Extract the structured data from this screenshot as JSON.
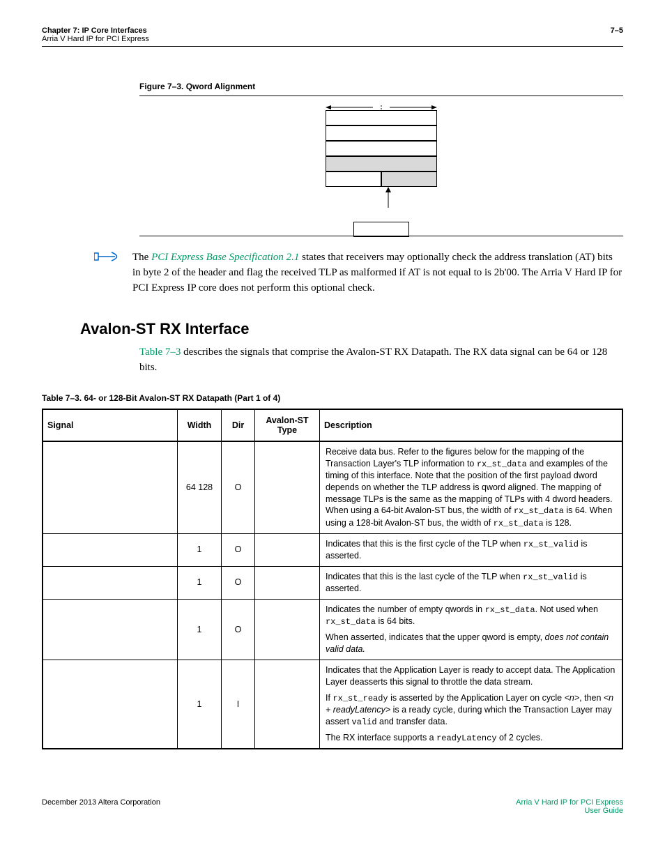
{
  "header": {
    "chapter": "Chapter 7: IP Core Interfaces",
    "subtitle": "Arria V Hard IP for PCI Express",
    "pagenum": "7–5"
  },
  "figure": {
    "caption": "Figure 7–3.  Qword Alignment"
  },
  "note": {
    "pre": "The ",
    "link": "PCI Express Base Specification 2.1",
    "post": " states that receivers may optionally check the address translation (AT) bits in byte 2 of the header and flag the received TLP as malformed if AT is not equal to is 2b'00. The Arria  V Hard IP for PCI Express IP core does not perform this optional check."
  },
  "section_title": "Avalon-ST RX Interface",
  "section_body": {
    "ref": "Table 7–3",
    "rest": " describes the signals that comprise the Avalon-ST RX Datapath. The RX data signal can be 64 or 128 bits."
  },
  "table": {
    "caption": "Table 7–3.  64- or 128-Bit Avalon-ST RX Datapath   (Part 1 of 4)",
    "headers": {
      "signal": "Signal",
      "width": "Width",
      "dir": "Dir",
      "avtype": "Avalon-ST Type",
      "desc": "Description"
    },
    "rows": [
      {
        "signal": "",
        "width": "64 128",
        "dir": "O",
        "avtype": "",
        "desc_parts": {
          "t1": "Receive data bus. Refer to the figures below for the mapping of the Transaction Layer's TLP information to ",
          "mono1": "rx_st_data",
          "t2": " and examples of the timing of this interface. Note that the position of the first payload dword depends on whether the TLP address is qword aligned. The mapping of message TLPs is the same as the mapping of TLPs with 4 dword headers. When using a 64-bit Avalon-ST bus, the width of ",
          "mono2": "rx_st_data",
          "t3": " is 64. When using a 128-bit Avalon-ST bus, the width of ",
          "mono3": "rx_st_data",
          "t4": " is 128."
        }
      },
      {
        "signal": "",
        "width": "1",
        "dir": "O",
        "avtype": "",
        "desc_parts": {
          "t1": "Indicates that this is the first cycle of the TLP when ",
          "mono1": "rx_st_valid",
          "t2": " is asserted."
        }
      },
      {
        "signal": "",
        "width": "1",
        "dir": "O",
        "avtype": "",
        "desc_parts": {
          "t1": "Indicates that this is the last cycle of the TLP when ",
          "mono1": "rx_st_valid",
          "t2": " is asserted."
        }
      },
      {
        "signal": "",
        "width": "1",
        "dir": "O",
        "avtype": "",
        "desc_parts": {
          "t1": "Indicates the number of empty qwords in ",
          "mono1": "rx_st_data",
          "t2": ". Not used when ",
          "mono2": "rx_st_data",
          "t3": " is 64 bits.",
          "p2": "When asserted, indicates that the upper qword is empty, ",
          "ital": "does not contain valid data.",
          "p2end": ""
        }
      },
      {
        "signal": "",
        "width": "1",
        "dir": "I",
        "avtype": "",
        "desc_parts": {
          "p1": "Indicates that the Application Layer is ready to accept data. The Application Layer deasserts this signal to throttle the data stream.",
          "p2a": "If ",
          "mono1": "rx_st_ready",
          "p2b": " is asserted by the Application Layer on cycle ",
          "ital1": "<n>",
          "p2c": ", then ",
          "ital2": "<n + readyLatency>",
          "p2d": " is a ready cycle, during which the Transaction Layer may assert ",
          "mono2": "valid",
          "p2e": " and transfer data.",
          "p3a": "The RX interface supports a ",
          "mono3": "readyLatency",
          "p3b": " of 2 cycles."
        }
      }
    ]
  },
  "footer": {
    "left": "December 2013   Altera Corporation",
    "right1": "Arria V Hard IP for PCI Express",
    "right2": "User Guide"
  }
}
